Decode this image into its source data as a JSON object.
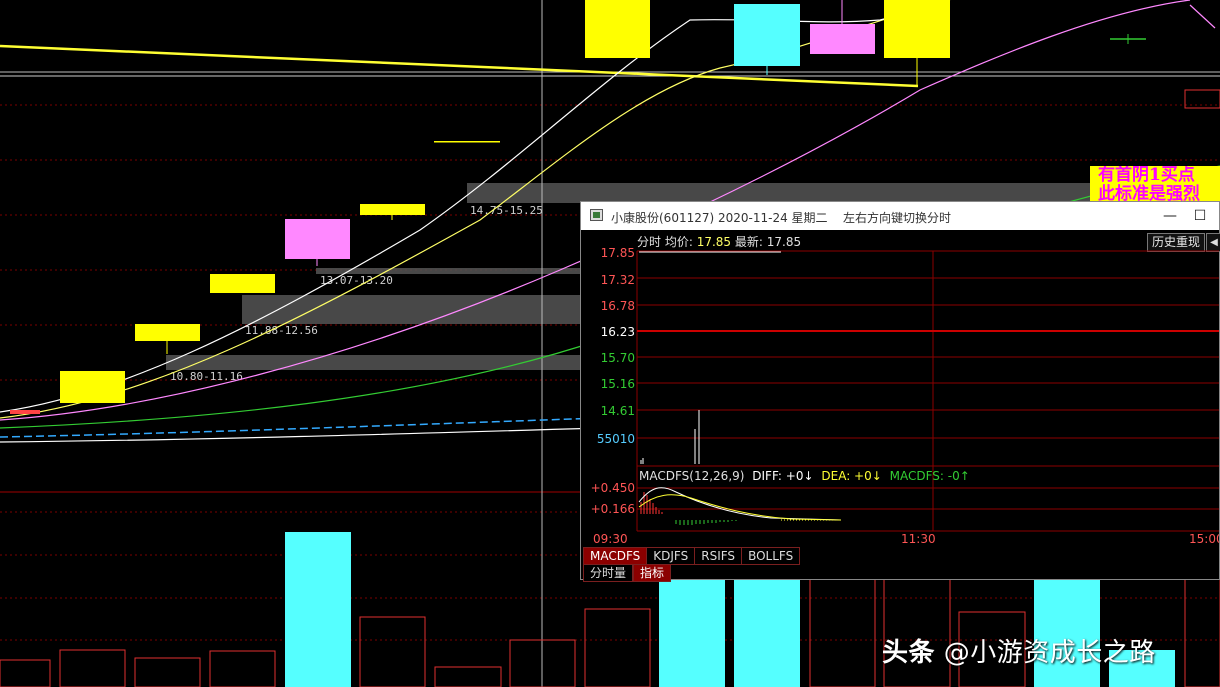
{
  "chart_data": [
    {
      "type": "candlestick",
      "name": "",
      "zone_labels": [
        "10.80-11.16",
        "11.88-12.56",
        "13.07-13.20",
        "14.75-15.25"
      ],
      "colors": {
        "up_candle": "#ffff00",
        "flat_candle": "#ff88ff",
        "down_candle": "#55ffff",
        "ma_white": "#ffffff",
        "ma_yellow": "#ffff33",
        "ma_magenta": "#ff88ff",
        "ma_green": "#33cc33",
        "zone_band": "#555555",
        "volume_red_border": "#e03030",
        "volume_cyan": "#55ffff"
      }
    },
    {
      "type": "line",
      "name": "intraday",
      "y_ticks": [
        "17.85",
        "17.32",
        "16.78",
        "16.23",
        "15.70",
        "15.16",
        "14.61",
        "55010"
      ],
      "x_ticks": [
        "09:30",
        "11:30",
        "15:00"
      ],
      "macd_ticks": [
        "+0.450",
        "+0.166"
      ]
    }
  ],
  "signal": {
    "line1": "有首阴1买点",
    "line2": "此标准是强烈"
  },
  "popup": {
    "title": "小康股份(601127) 2020-11-24 星期二",
    "hint": "左右方向键切换分时",
    "min_button": "—",
    "max_button": "☐",
    "info_label": "分时 均价:",
    "avg_price": "17.85",
    "latest_label": "最新:",
    "latest_price": "17.85",
    "history_button": "历史重现",
    "history_arrow": "◀",
    "macd_label": "MACDFS(12,26,9)",
    "diff_text": "DIFF: +0↓",
    "dea_text": "DEA: +0↓",
    "macdfs_text": "MACDFS: -0↑",
    "tabs": [
      "MACDFS",
      "KDJFS",
      "RSIFS",
      "BOLLFS"
    ],
    "tabs2": [
      "分时量",
      "指标"
    ]
  },
  "watermark": {
    "brand": "头条",
    "handle": "@小游资成长之路"
  }
}
